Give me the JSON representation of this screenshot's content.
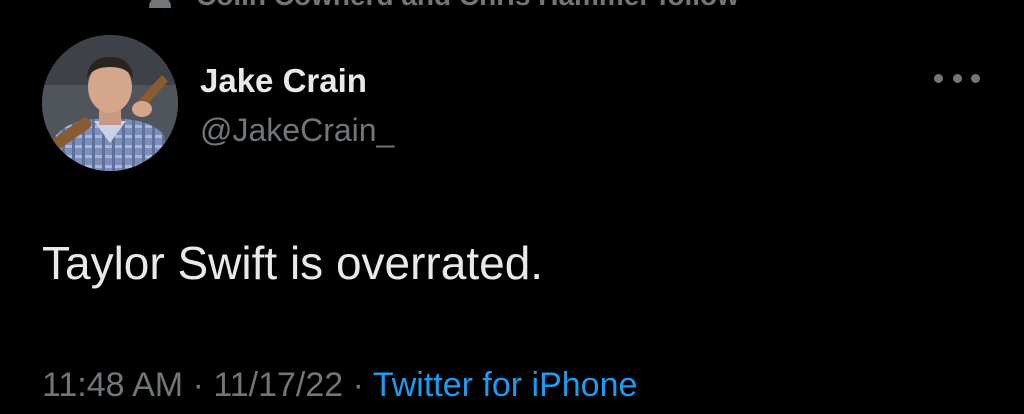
{
  "social_context": {
    "text": "Colin Cowherd and Chris Hammer follow",
    "icon": "person-icon"
  },
  "author": {
    "display_name": "Jake Crain",
    "handle": "@JakeCrain_",
    "avatar": "avatar-photo"
  },
  "tweet": {
    "text": "Taylor Swift is overrated.",
    "time": "11:48 AM",
    "date": "11/17/22",
    "separator": "·",
    "source": "Twitter for iPhone"
  },
  "colors": {
    "background": "#000000",
    "primary_text": "#e7e9ea",
    "secondary_text": "#71767b",
    "link": "#1d9bf0"
  }
}
